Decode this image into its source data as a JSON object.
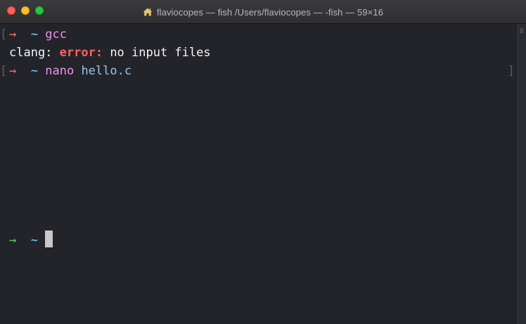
{
  "window": {
    "title": "flaviocopes — fish  /Users/flaviocopes — -fish — 59×16"
  },
  "terminal": {
    "lines": [
      {
        "prompt_arrow": "→",
        "cwd": "~",
        "command": "gcc",
        "args": ""
      },
      {
        "output_prefix": "clang: ",
        "output_error": "error:",
        "output_suffix": " no input files"
      },
      {
        "prompt_arrow": "→",
        "cwd": "~",
        "command": "nano",
        "args": "hello.c"
      }
    ],
    "current_prompt": {
      "prompt_arrow": "→",
      "cwd": "~"
    },
    "bracket_left": "[",
    "bracket_right": "]"
  },
  "scrollbar": {
    "mark": "B"
  },
  "colors": {
    "background": "#23242a",
    "error": "#ff6161",
    "command": "#f08ff0",
    "cwd": "#7fd6ff",
    "arrow_prev": "#ff6e6e",
    "arrow_current": "#5ad15a"
  }
}
